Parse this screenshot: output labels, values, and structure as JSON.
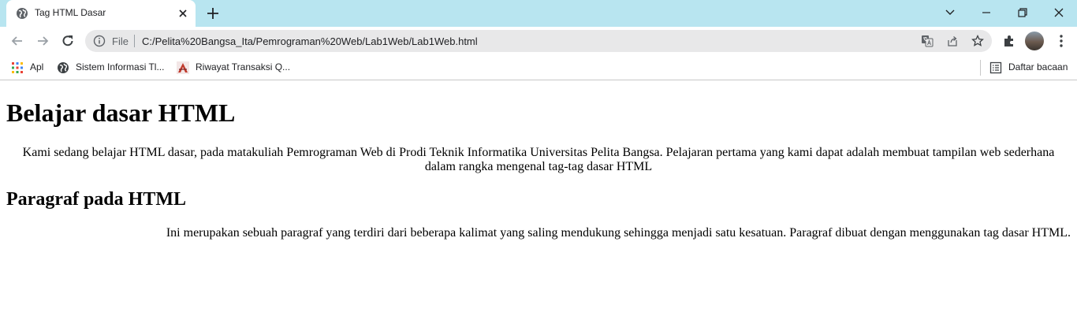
{
  "browser": {
    "tab": {
      "title": "Tag HTML Dasar",
      "favicon": "globe-icon"
    },
    "omnibox": {
      "scheme_label": "File",
      "url": "C:/Pelita%20Bangsa_Ita/Pemrograman%20Web/Lab1Web/Lab1Web.html"
    },
    "bookmarks": [
      {
        "label": "Apl",
        "icon": "apps-grid-icon"
      },
      {
        "label": "Sistem Informasi Tl...",
        "icon": "globe-icon"
      },
      {
        "label": "Riwayat Transaksi Q...",
        "icon": "bookmark-logo-icon"
      }
    ],
    "reading_list_label": "Daftar bacaan",
    "colors": {
      "tabstrip": "#b8e5f0",
      "omnibox": "#e8e8e9",
      "text": "#202124"
    }
  },
  "page": {
    "heading1": "Belajar dasar HTML",
    "paragraph1": "Kami sedang belajar HTML dasar, pada matakuliah Pemrograman Web di Prodi Teknik Informatika Universitas Pelita Bangsa. Pelajaran pertama yang kami dapat adalah membuat tampilan web sederhana dalam rangka mengenal tag-tag dasar HTML",
    "heading2": "Paragraf pada HTML",
    "paragraph2": "Ini merupakan sebuah paragraf yang terdiri dari beberapa kalimat yang saling mendukung sehingga menjadi satu kesatuan. Paragraf dibuat dengan menggunakan tag dasar HTML."
  }
}
